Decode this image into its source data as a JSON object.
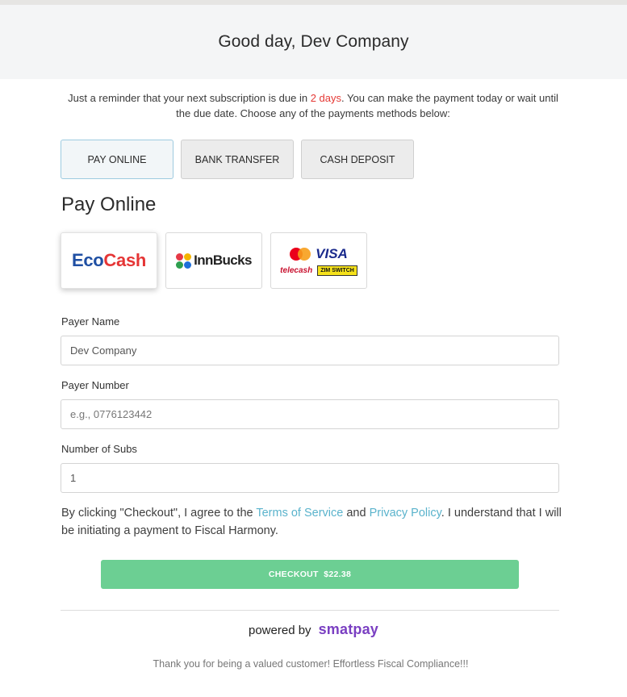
{
  "header": {
    "greeting": "Good day, Dev Company"
  },
  "reminder": {
    "prefix": "Just a reminder that your next subscription is due in ",
    "due": "2 days",
    "suffix": ". You can make the payment today or wait until the due date. Choose any of the payments methods below:"
  },
  "tabs": [
    {
      "label": "PAY ONLINE",
      "active": true
    },
    {
      "label": "BANK TRANSFER",
      "active": false
    },
    {
      "label": "CASH DEPOSIT",
      "active": false
    }
  ],
  "section_title": "Pay Online",
  "providers": {
    "ecocash": {
      "part1": "Eco",
      "part2": "Cash"
    },
    "innbucks": {
      "text": "InnBucks"
    },
    "cards": {
      "visa": "VISA",
      "telecash": "telecash",
      "zimswitch": "ZIM SWITCH",
      "mastercard": "mastercard"
    }
  },
  "form": {
    "payer_name": {
      "label": "Payer Name",
      "value": "Dev Company",
      "placeholder": ""
    },
    "payer_number": {
      "label": "Payer Number",
      "value": "",
      "placeholder": "e.g., 0776123442"
    },
    "num_subs": {
      "label": "Number of Subs",
      "value": "1",
      "placeholder": ""
    }
  },
  "agreement": {
    "prefix": "By clicking \"Checkout\", I agree to the ",
    "terms": "Terms of Service",
    "and": " and ",
    "privacy": "Privacy Policy",
    "suffix": ". I understand that I will be initiating a payment to Fiscal Harmony."
  },
  "checkout": {
    "label": "CHECKOUT  $22.38"
  },
  "powered": {
    "prefix": "powered by",
    "brand": "smatpay"
  },
  "footer": {
    "thanks": "Thank you for being a valued customer! Effortless Fiscal Compliance!!!"
  },
  "colors": {
    "accent_green": "#6ccf93",
    "link": "#5ab3cc",
    "due_red": "#e53935",
    "brand_purple": "#7a3fc2",
    "ecocash_blue": "#1f4fa3",
    "ecocash_red": "#e53535",
    "innbucks_dots": [
      "#e63946",
      "#f4b400",
      "#2e9e4f",
      "#1e6fd9"
    ],
    "mastercard_red": "#eb001b",
    "mastercard_orange": "#f79e1b"
  }
}
